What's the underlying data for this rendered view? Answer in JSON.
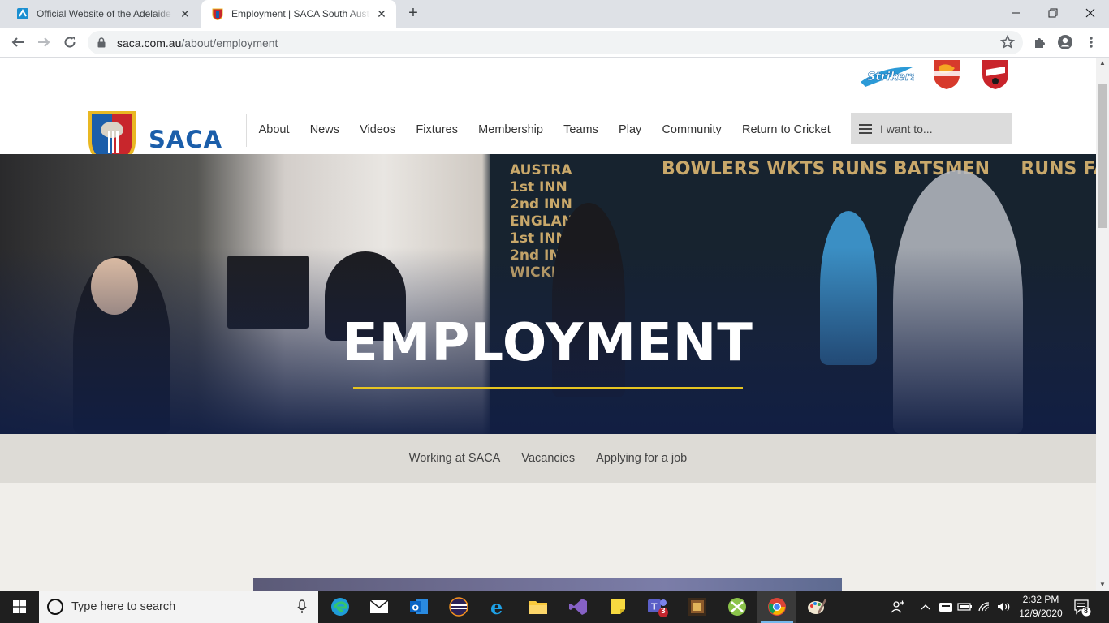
{
  "browser": {
    "tabs": [
      {
        "title": "Official Website of the Adelaide Strikers",
        "active": false
      },
      {
        "title": "Employment | SACA South Australian Cricket Association",
        "active": true
      }
    ],
    "url_host": "saca.com.au",
    "url_path": "/about/employment"
  },
  "site": {
    "logo_text": "SACA",
    "partner_logos": [
      "Adelaide Strikers",
      "Adelaide Scorpions",
      "Redbacks"
    ],
    "nav": [
      "About",
      "News",
      "Videos",
      "Fixtures",
      "Membership",
      "Teams",
      "Play",
      "Community",
      "Return to Cricket"
    ],
    "i_want_to": "I want to...",
    "hero_title": "EMPLOYMENT",
    "subnav": [
      "Working at SACA",
      "Vacancies",
      "Applying for a job"
    ],
    "accent_color": "#e6c421",
    "brand_blue": "#1b5eaa"
  },
  "taskbar": {
    "search_placeholder": "Type here to search",
    "teams_badge": "3",
    "time": "2:32 PM",
    "date": "12/9/2020",
    "notifications": "8"
  }
}
